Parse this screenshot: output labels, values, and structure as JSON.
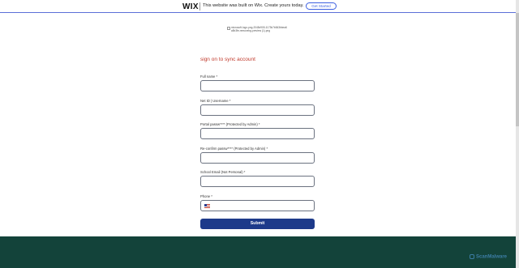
{
  "banner": {
    "logo": "WIX",
    "message": "This website was built on Wix. Create yours today.",
    "cta": "Get Started"
  },
  "logo_image": {
    "alt": "microsoft-logo-png-2048x905-1173b7b843bbea6a5b3fe-removebg-preview (1).png"
  },
  "form": {
    "title": "sign on to sync account",
    "fields": [
      {
        "label": "Full name *"
      },
      {
        "label": "Net ID | Username  *"
      },
      {
        "label": "Portal passw**** (Protected by Admin)  *"
      },
      {
        "label": "Re-confirm passw**** (Protected by Admin)  *"
      },
      {
        "label": "School Email (Not Personal)  *"
      },
      {
        "label": "Phone *"
      }
    ],
    "submit": "Submit"
  },
  "watermark": "ScanMalware",
  "colors": {
    "title": "#c0392b",
    "submit": "#1d3a8a",
    "footer": "#13433a",
    "banner_accent": "#3b5fe0"
  }
}
